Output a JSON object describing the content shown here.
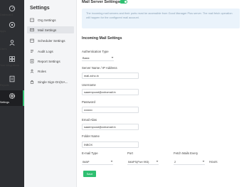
{
  "rail": {
    "items": [
      {
        "label": "Dashboard",
        "icon": "dashboard-icon"
      },
      {
        "label": "Apps",
        "icon": "apps-icon"
      },
      {
        "label": "Users",
        "icon": "users-icon"
      },
      {
        "label": "Your Integrations",
        "icon": "integrations-icon"
      },
      {
        "label": "Reports",
        "icon": "reports-icon"
      },
      {
        "label": "Settings",
        "icon": "settings-icon"
      }
    ],
    "active": "Settings"
  },
  "sidebar": {
    "title": "Settings",
    "items": [
      {
        "label": "Org Settings",
        "icon": "org-icon"
      },
      {
        "label": "Mail Settings",
        "icon": "mail-icon"
      },
      {
        "label": "Scheduler Settings",
        "icon": "scheduler-icon"
      },
      {
        "label": "Audit Logs",
        "icon": "audit-icon"
      },
      {
        "label": "Report Settings",
        "icon": "report-settings-icon"
      },
      {
        "label": "Roles",
        "icon": "roles-icon"
      },
      {
        "label": "Single Sign-On(SA...",
        "icon": "sso-icon"
      }
    ],
    "active": "Mail Settings"
  },
  "header": {
    "title": "Mail Server Settings",
    "toggle_on": true
  },
  "info_text": "The incoming mail servers and their ports must be accessible from Good Manager Plus server. The mail fetch operation will happen for the configured mail account.",
  "form": {
    "section_title": "Incoming Mail Settings",
    "auth_type": {
      "label": "Authentication Type",
      "value": "Basic"
    },
    "server": {
      "label": "Server Name / IP Address",
      "value": "mail.zoho.in"
    },
    "username": {
      "label": "Username",
      "value": "saaempcost@zohomail.in"
    },
    "password": {
      "label": "Password",
      "value": "••••••••••"
    },
    "email_alias": {
      "label": "Email Alias",
      "value": "saaempcost@zohomail.in"
    },
    "folder": {
      "label": "Folder Name",
      "value": "INBOX"
    },
    "email_type": {
      "label": "E-mail Type",
      "value": "IMAP"
    },
    "port": {
      "label": "Port",
      "value": "IMAPS(Port 993)"
    },
    "fetch": {
      "label": "Fetch Mails Every",
      "value": "2",
      "unit": "Hours"
    },
    "save_label": "Save"
  },
  "colors": {
    "accent": "#2fbf71",
    "rail": "#2d2f33",
    "info_bg": "#eaf3fb"
  }
}
